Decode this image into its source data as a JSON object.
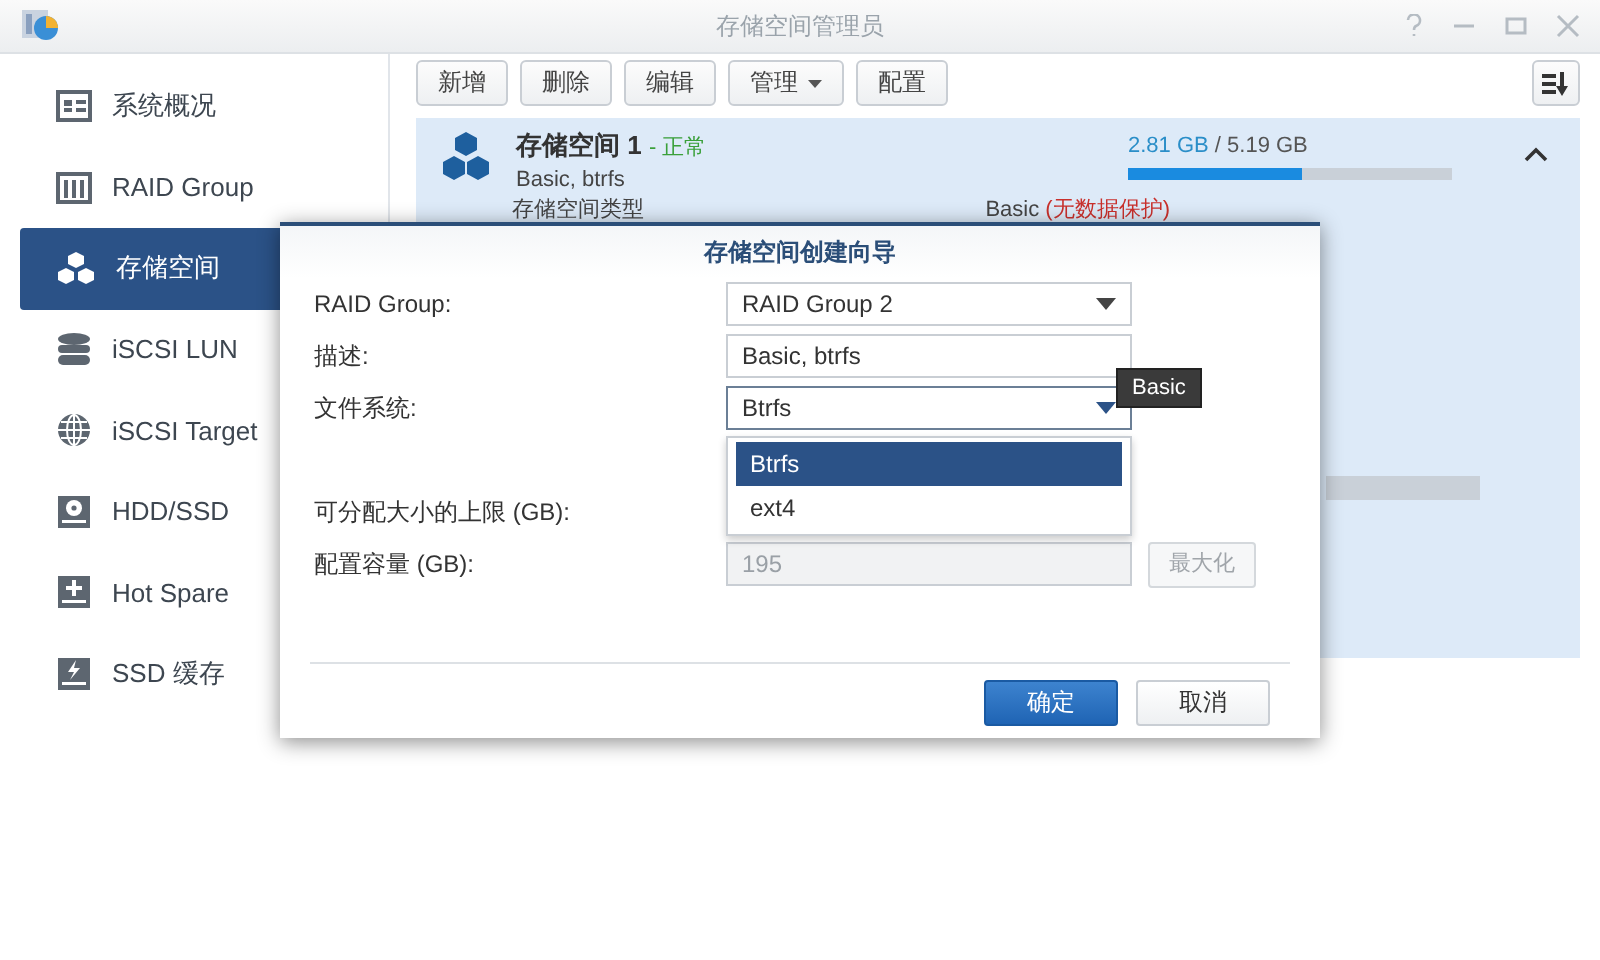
{
  "window": {
    "title": "存储空间管理员"
  },
  "sidebar": {
    "items": [
      {
        "label": "系统概况",
        "selected": false
      },
      {
        "label": "RAID Group",
        "selected": false
      },
      {
        "label": "存储空间",
        "selected": true
      },
      {
        "label": "iSCSI LUN",
        "selected": false
      },
      {
        "label": "iSCSI Target",
        "selected": false
      },
      {
        "label": "HDD/SSD",
        "selected": false
      },
      {
        "label": "Hot Spare",
        "selected": false
      },
      {
        "label": "SSD 缓存",
        "selected": false
      }
    ]
  },
  "toolbar": {
    "buttons": [
      {
        "label": "新增",
        "kind": "button"
      },
      {
        "label": "删除",
        "kind": "button"
      },
      {
        "label": "编辑",
        "kind": "button"
      },
      {
        "label": "管理",
        "kind": "menu"
      },
      {
        "label": "配置",
        "kind": "button"
      }
    ]
  },
  "volume": {
    "title": "存储空间 1",
    "status_separator": "-",
    "status": "正常",
    "description": "Basic, btrfs",
    "used": "2.81 GB",
    "size_separator": "/",
    "total": "5.19 GB",
    "level": 0.54,
    "expanded": true,
    "detail_label": "存储空间类型",
    "detail_value": "Basic",
    "detail_note": "(无数据保护)"
  },
  "dialog": {
    "title": "存储空间创建向导",
    "fields": [
      {
        "label": "RAID Group:",
        "kind": "select",
        "value": "RAID Group 2",
        "focused": false
      },
      {
        "label": "描述:",
        "kind": "text",
        "value": "Basic, btrfs",
        "focused": false
      },
      {
        "label": "文件系统:",
        "kind": "select",
        "value": "Btrfs",
        "focused": true
      },
      {
        "label": "可分配大小的上限 (GB):",
        "kind": "label"
      },
      {
        "label": "配置容量 (GB):",
        "kind": "number",
        "value": "195",
        "disabled": true,
        "button": "最大化"
      }
    ],
    "dropdown": {
      "options": [
        {
          "label": "Btrfs",
          "selected": true
        },
        {
          "label": "ext4",
          "selected": false
        }
      ]
    },
    "tooltip": "Basic",
    "buttons": [
      {
        "label": "确定",
        "primary": true
      },
      {
        "label": "取消",
        "primary": false
      }
    ]
  }
}
